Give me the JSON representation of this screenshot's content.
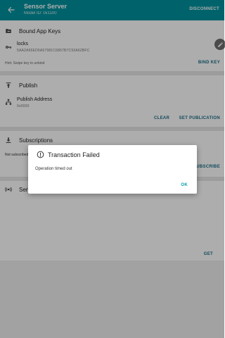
{
  "app_bar": {
    "title": "Sensor Server",
    "subtitle": "Model ID: 0x1100",
    "action": "DISCONNECT",
    "back_icon": "arrow-back-icon"
  },
  "bound_app_keys": {
    "title": "Bound App Keys",
    "icon": "folder-key-icon",
    "key_name": "locks",
    "key_value": "5AA2A65ED5A57981C6857B7C93A62BFC",
    "hint": "Hint: Swipe key to unbind",
    "bind_button": "BIND KEY"
  },
  "publish": {
    "title": "Publish",
    "icon": "publish-icon",
    "address_label": "Publish Address",
    "address_value": "0x0000",
    "clear_button": "CLEAR",
    "set_button": "SET PUBLICATION"
  },
  "subscriptions": {
    "title": "Subscriptions",
    "icon": "download-icon",
    "empty_text": "Not subscribed",
    "button": "SUBSCRIBE"
  },
  "sensor": {
    "title": "Sen",
    "icon": "sensor-icon",
    "get_button": "GET"
  },
  "dialog": {
    "title": "Transaction Failed",
    "message": "Operation timed out",
    "ok_button": "OK"
  }
}
